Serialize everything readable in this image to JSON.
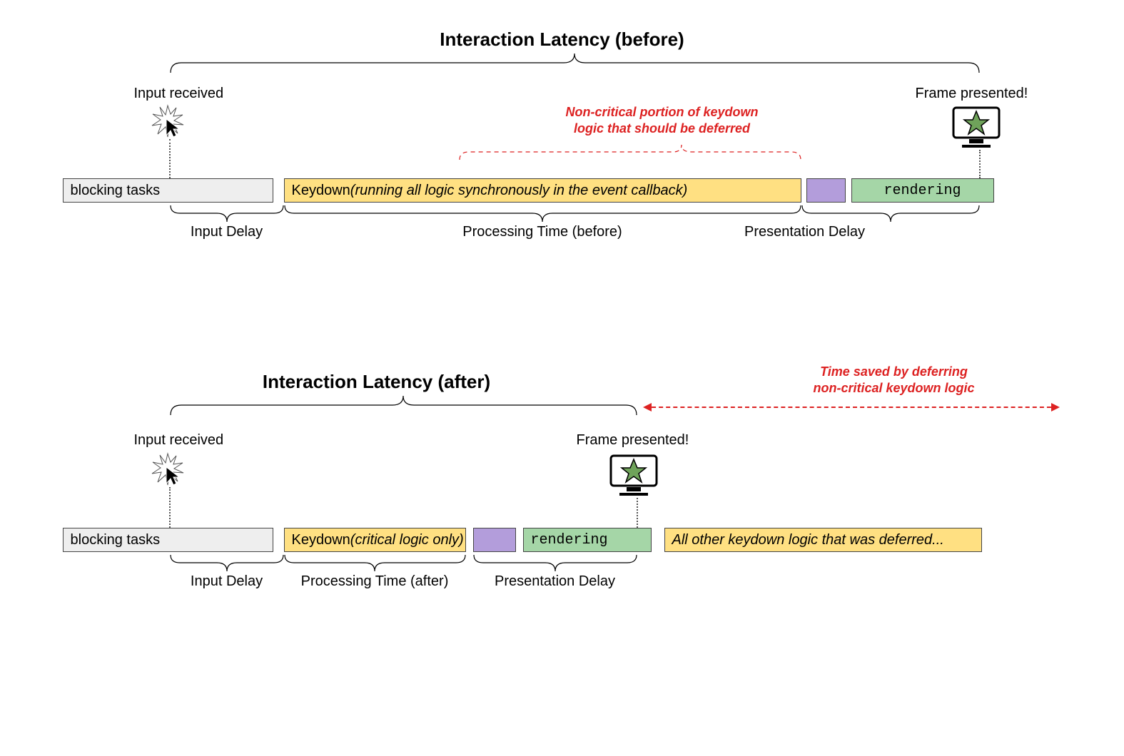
{
  "before": {
    "title": "Interaction Latency (before)",
    "input_received": "Input received",
    "frame_presented": "Frame presented!",
    "deferred_annotation": "Non-critical portion of keydown\nlogic that should be deferred",
    "blocks": {
      "blocking": "blocking tasks",
      "keydown_prefix": "Keydown ",
      "keydown_suffix": "(running all logic synchronously in the event callback)",
      "rendering": "rendering"
    },
    "braces": {
      "input_delay": "Input Delay",
      "processing_time": "Processing Time (before)",
      "presentation_delay": "Presentation Delay"
    }
  },
  "after": {
    "title": "Interaction Latency (after)",
    "input_received": "Input received",
    "frame_presented": "Frame presented!",
    "time_saved": "Time saved by deferring\nnon-critical keydown logic",
    "blocks": {
      "blocking": "blocking tasks",
      "keydown_prefix": "Keydown ",
      "keydown_suffix": "(critical logic only)",
      "rendering": "rendering",
      "deferred_suffix": "All other keydown logic that was deferred..."
    },
    "braces": {
      "input_delay": "Input Delay",
      "processing_time": "Processing Time (after)",
      "presentation_delay": "Presentation Delay"
    }
  }
}
